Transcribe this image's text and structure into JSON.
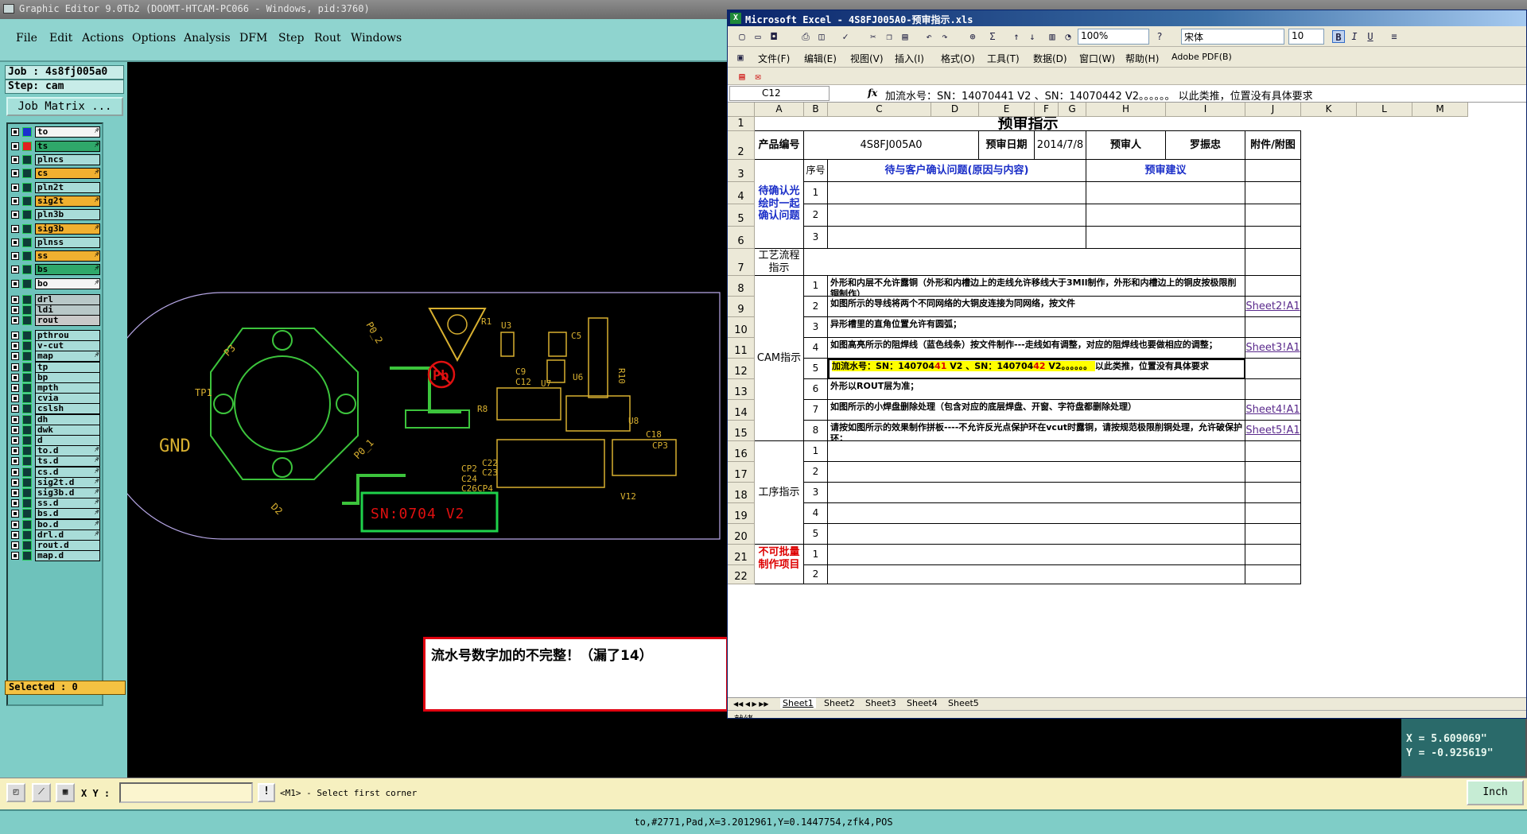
{
  "genesis": {
    "title": "Graphic Editor 9.0Tb2 (DOOMT-HTCAM-PC066 - Windows, pid:3760)",
    "menus": [
      "File",
      "Edit",
      "Actions",
      "Options",
      "Analysis",
      "DFM",
      "Step",
      "Rout",
      "Windows"
    ],
    "job": "Job : 4s8fj005a0",
    "step": "Step: cam",
    "job_matrix_button": "Job Matrix ...",
    "layers": [
      {
        "name": "to",
        "style": "white",
        "flag": "♐"
      },
      {
        "name": "ts",
        "style": "green",
        "flag": "♐"
      },
      {
        "name": "plncs",
        "style": ""
      },
      {
        "name": "cs",
        "style": "orange",
        "flag": "♐"
      },
      {
        "name": "pln2t",
        "style": ""
      },
      {
        "name": "sig2t",
        "style": "orange",
        "flag": "♐"
      },
      {
        "name": "pln3b",
        "style": ""
      },
      {
        "name": "sig3b",
        "style": "orange",
        "flag": "♐"
      },
      {
        "name": "plnss",
        "style": ""
      },
      {
        "name": "ss",
        "style": "orange",
        "flag": "♐"
      },
      {
        "name": "bs",
        "style": "green",
        "flag": "♐"
      },
      {
        "name": "bo",
        "style": "white",
        "flag": "♐"
      },
      {
        "name": "drl",
        "style": "gray2"
      },
      {
        "name": "ldi",
        "style": "gray2"
      },
      {
        "name": "rout",
        "style": "grey"
      },
      {
        "name": "pthrou",
        "style": ""
      },
      {
        "name": "v-cut",
        "style": ""
      },
      {
        "name": "map",
        "style": "",
        "flag": "♐"
      },
      {
        "name": "tp",
        "style": ""
      },
      {
        "name": "bp",
        "style": ""
      },
      {
        "name": "mpth",
        "style": ""
      },
      {
        "name": "cvia",
        "style": ""
      },
      {
        "name": "cslsh",
        "style": ""
      },
      {
        "name": "dh",
        "style": ""
      },
      {
        "name": "dwk",
        "style": ""
      },
      {
        "name": "d",
        "style": ""
      },
      {
        "name": "to.d",
        "style": "",
        "flag": "♐"
      },
      {
        "name": "ts.d",
        "style": "",
        "flag": "♐"
      },
      {
        "name": "cs.d",
        "style": "",
        "flag": "♐"
      },
      {
        "name": "sig2t.d",
        "style": "",
        "flag": "♐"
      },
      {
        "name": "sig3b.d",
        "style": "",
        "flag": "♐"
      },
      {
        "name": "ss.d",
        "style": "",
        "flag": "♐"
      },
      {
        "name": "bs.d",
        "style": "",
        "flag": "♐"
      },
      {
        "name": "bo.d",
        "style": "",
        "flag": "♐"
      },
      {
        "name": "drl.d",
        "style": "",
        "flag": "♐"
      },
      {
        "name": "rout.d",
        "style": ""
      },
      {
        "name": "map.d",
        "style": ""
      }
    ],
    "selected": "Selected : 0",
    "annotation": "流水号数字加的不完整！（漏了14）",
    "pcb_labels": {
      "gnd": "GND",
      "sn": "SN:0704    V2",
      "pb": "Pb",
      "tp1": "TP1",
      "p3": "P3",
      "p0_2": "P0_2",
      "p0_1": "P0_1",
      "d2": "D2",
      "u3": "U3",
      "u6": "U6",
      "u7": "U7",
      "u8": "U8",
      "v12": "V12",
      "r8": "R8",
      "r1": "R1",
      "c9": "C9",
      "c12": "C12",
      "c18": "C18",
      "cp3": "CP3",
      "cp4": "CP4",
      "cp2": "CP2",
      "c22": "C22",
      "c23": "C23",
      "c24": "C24",
      "c26": "C26",
      "c5": "C5",
      "r10": "R10"
    },
    "xy_label": "X Y :",
    "xy_value": "",
    "prompt": "<M1> - Select first corner",
    "unit": "Inch",
    "coord_x": "X = 5.609069\"",
    "coord_y": "Y = -0.925619\"",
    "status": "to,#2771,Pad,X=3.2012961,Y=0.1447754,zfk4,POS"
  },
  "excel": {
    "title": "Microsoft Excel - 4S8FJ005A0-预审指示.xls",
    "zoom": "100%",
    "font": "宋体",
    "font_size": "10",
    "menus": [
      "文件(F)",
      "编辑(E)",
      "视图(V)",
      "插入(I)",
      "格式(O)",
      "工具(T)",
      "数据(D)",
      "窗口(W)",
      "帮助(H)",
      "Adobe PDF(B)"
    ],
    "name_box": "C12",
    "fx": "fx",
    "formula": "加流水号：SN：14070441 V2 、SN：14070442 V2。。。。。。  以此类推，位置没有具体要求",
    "columns": [
      "A",
      "B",
      "C",
      "D",
      "E",
      "F",
      "G",
      "H",
      "I",
      "J",
      "K",
      "L",
      "M"
    ],
    "rows": [
      "1",
      "2",
      "3",
      "4",
      "5",
      "6",
      "7",
      "8",
      "9",
      "10",
      "11",
      "12",
      "13",
      "14",
      "15",
      "16",
      "17",
      "18",
      "19",
      "20",
      "21",
      "22"
    ],
    "title_cell": "预审指示",
    "product_no_label": "产品编号",
    "product_no": "4S8FJ005A0",
    "date_label": "预审日期",
    "date": "2014/7/8",
    "reviewer_label": "预审人",
    "reviewer": "罗振忠",
    "attach_label": "附件/附图",
    "seq_label": "序号",
    "issue_label": "待与客户确认问题(原因与内容)",
    "suggest_label": "预审建议",
    "confirm_group": "待确认光绘时一起确认问题",
    "process_label": "工艺流程指示",
    "cam_label": "CAM指示",
    "procedure_label": "工序指示",
    "nobatch_label": "不可批量制作项目",
    "cam_items": [
      {
        "no": "1",
        "text": "外形和内层不允许露铜（外形和内槽边上的走线允许移线大于3MIl制作，外形和内槽边上的铜皮按极限削铜制作）",
        "link": ""
      },
      {
        "no": "2",
        "text": "如图所示的导线将两个不同网络的大铜皮连接为同网络，按文件",
        "link": "Sheet2!A1"
      },
      {
        "no": "3",
        "text": "异形槽里的直角位置允许有圆弧；",
        "link": ""
      },
      {
        "no": "4",
        "text": "如图高亮所示的阻焊线（蓝色线条）按文件制作---走线如有调整，对应的阻焊线也要做相应的调整；",
        "link": "Sheet3!A1"
      },
      {
        "no": "5",
        "text": "",
        "link": ""
      },
      {
        "no": "6",
        "text": "外形以ROUT层为准；",
        "link": ""
      },
      {
        "no": "7",
        "text": "如图所示的小焊盘删除处理（包含对应的底层焊盘、开窗、字符盘都删除处理）",
        "link": "Sheet4!A1"
      },
      {
        "no": "8",
        "text": "请按如图所示的效果制作拼板----不允许反光点保护环在vcut时露铜，请按规范极限削铜处理，允许破保护环；",
        "link": "Sheet5!A1"
      }
    ],
    "row12_parts": {
      "a": "加流水号：SN：140704",
      "b": "41",
      "c": " V2 、SN：140704",
      "d": "42",
      "e": " V2。。。。。。  ",
      "f": "以此类推，位置没有具体要求"
    },
    "seq_numbers": [
      "1",
      "2",
      "3"
    ],
    "procedure_numbers": [
      "1",
      "2",
      "3",
      "4",
      "5"
    ],
    "nobatch_numbers": [
      "1",
      "2"
    ],
    "sheets": [
      "Sheet1",
      "Sheet2",
      "Sheet3",
      "Sheet4",
      "Sheet5"
    ],
    "status": "就绪"
  }
}
